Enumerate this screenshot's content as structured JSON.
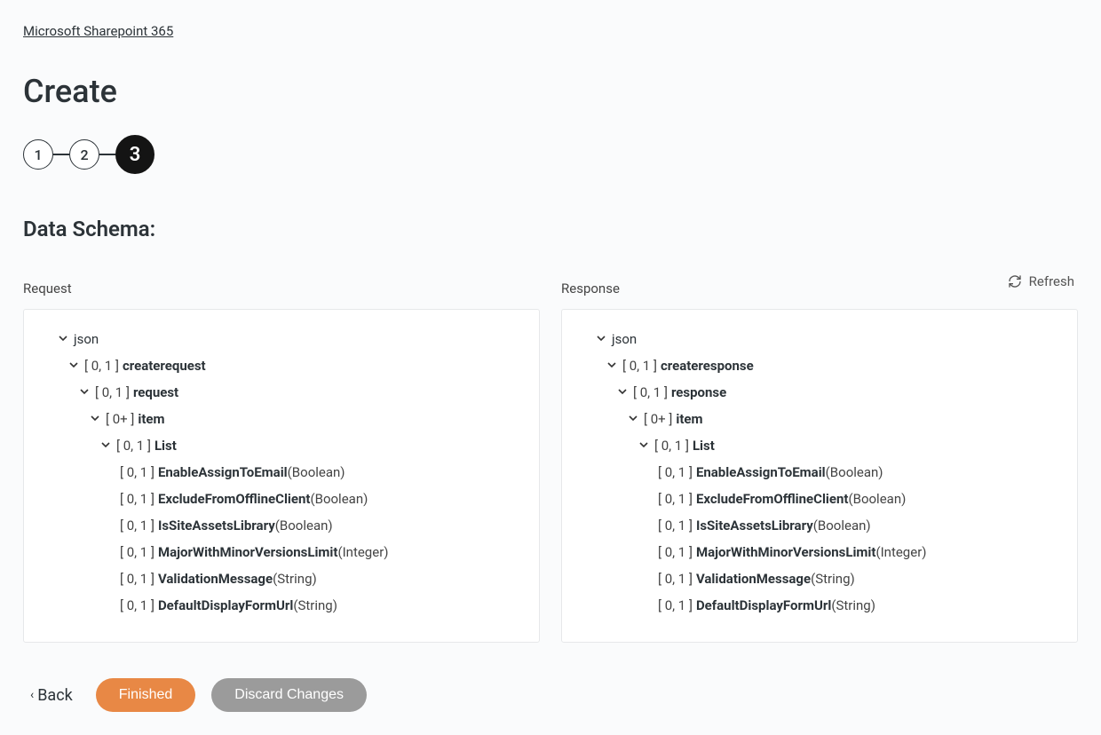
{
  "breadcrumb": "Microsoft Sharepoint 365",
  "page_title": "Create",
  "steps": [
    "1",
    "2",
    "3"
  ],
  "active_step_index": 2,
  "section_title": "Data Schema:",
  "refresh_label": "Refresh",
  "request_label": "Request",
  "response_label": "Response",
  "btn_back": "Back",
  "btn_finished": "Finished",
  "btn_discard": "Discard Changes",
  "root_label": "json",
  "request_tree": {
    "root": {
      "card": "[ 0, 1 ]",
      "name": "createrequest"
    },
    "l2": {
      "card": "[ 0, 1 ]",
      "name": "request"
    },
    "l3": {
      "card": "[ 0+ ]",
      "name": "item"
    },
    "l4": {
      "card": "[ 0, 1 ]",
      "name": "List"
    },
    "fields": [
      {
        "card": "[ 0, 1 ]",
        "name": "EnableAssignToEmail",
        "type": "(Boolean)"
      },
      {
        "card": "[ 0, 1 ]",
        "name": "ExcludeFromOfflineClient",
        "type": "(Boolean)"
      },
      {
        "card": "[ 0, 1 ]",
        "name": "IsSiteAssetsLibrary",
        "type": "(Boolean)"
      },
      {
        "card": "[ 0, 1 ]",
        "name": "MajorWithMinorVersionsLimit",
        "type": "(Integer)"
      },
      {
        "card": "[ 0, 1 ]",
        "name": "ValidationMessage",
        "type": "(String)"
      },
      {
        "card": "[ 0, 1 ]",
        "name": "DefaultDisplayFormUrl",
        "type": "(String)"
      }
    ]
  },
  "response_tree": {
    "root": {
      "card": "[ 0, 1 ]",
      "name": "createresponse"
    },
    "l2": {
      "card": "[ 0, 1 ]",
      "name": "response"
    },
    "l3": {
      "card": "[ 0+ ]",
      "name": "item"
    },
    "l4": {
      "card": "[ 0, 1 ]",
      "name": "List"
    },
    "fields": [
      {
        "card": "[ 0, 1 ]",
        "name": "EnableAssignToEmail",
        "type": "(Boolean)"
      },
      {
        "card": "[ 0, 1 ]",
        "name": "ExcludeFromOfflineClient",
        "type": "(Boolean)"
      },
      {
        "card": "[ 0, 1 ]",
        "name": "IsSiteAssetsLibrary",
        "type": "(Boolean)"
      },
      {
        "card": "[ 0, 1 ]",
        "name": "MajorWithMinorVersionsLimit",
        "type": "(Integer)"
      },
      {
        "card": "[ 0, 1 ]",
        "name": "ValidationMessage",
        "type": "(String)"
      },
      {
        "card": "[ 0, 1 ]",
        "name": "DefaultDisplayFormUrl",
        "type": "(String)"
      }
    ]
  }
}
